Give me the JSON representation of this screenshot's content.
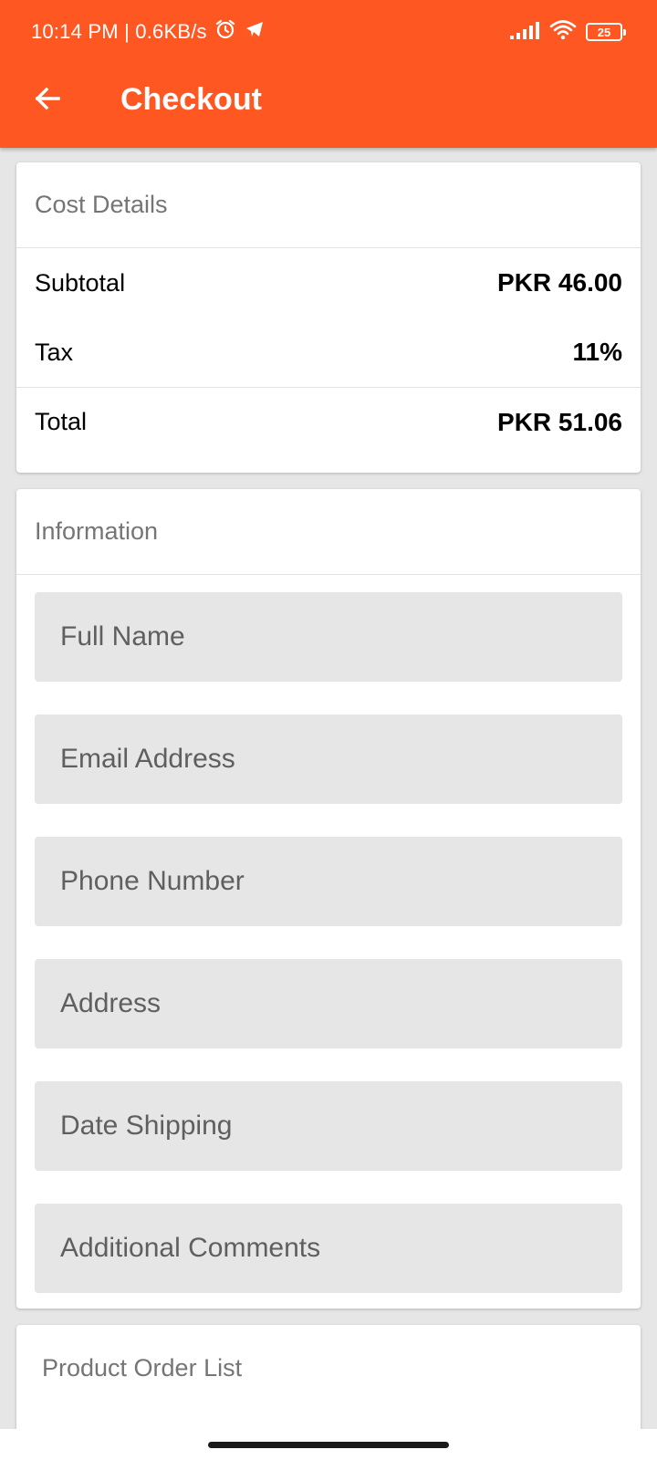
{
  "status_bar": {
    "time_speed": "10:14 PM | 0.6KB/s",
    "battery": "25"
  },
  "toolbar": {
    "title": "Checkout"
  },
  "cost_details": {
    "header": "Cost Details",
    "rows": [
      {
        "label": "Subtotal",
        "value": "PKR 46.00"
      },
      {
        "label": "Tax",
        "value": "11%"
      },
      {
        "label": "Total",
        "value": "PKR 51.06"
      }
    ]
  },
  "information": {
    "header": "Information",
    "fields": [
      {
        "placeholder": "Full Name"
      },
      {
        "placeholder": "Email Address"
      },
      {
        "placeholder": "Phone Number"
      },
      {
        "placeholder": "Address"
      },
      {
        "placeholder": "Date Shipping"
      },
      {
        "placeholder": "Additional Comments"
      }
    ]
  },
  "product_order_list": {
    "header": "Product Order List"
  },
  "colors": {
    "accent": "#ff5722",
    "background": "#e6e6e6",
    "field_background": "#e6e6e6"
  },
  "icons": [
    "alarm-icon",
    "telegram-icon",
    "signal-icon",
    "wifi-icon",
    "battery-icon",
    "back-arrow-icon"
  ]
}
